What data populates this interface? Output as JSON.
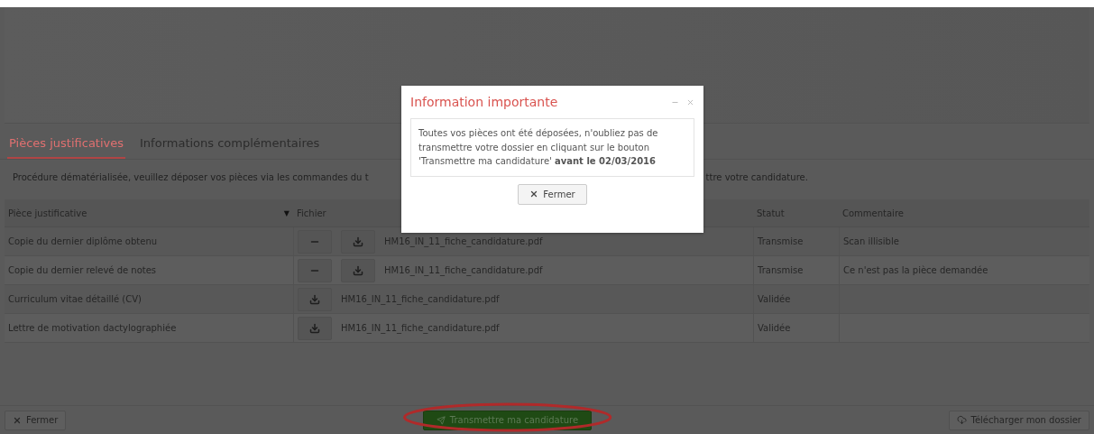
{
  "tabs": [
    {
      "label": "Pièces justificatives",
      "selected": true
    },
    {
      "label": "Informations complémentaires",
      "selected": false
    }
  ],
  "notice": {
    "before": "Procédure dématérialisée, veuillez déposer vos pièces via les commandes du t",
    "after": "ttre votre candidature."
  },
  "table": {
    "columns": [
      "Pièce justificative",
      "Fichier",
      "Statut",
      "Commentaire"
    ],
    "sort_indicator": "▼",
    "rows": [
      {
        "piece": "Copie du dernier diplôme obtenu",
        "removable": true,
        "file": "HM16_IN_11_fiche_candidature.pdf",
        "status": "Transmise",
        "comment": "Scan illisible"
      },
      {
        "piece": "Copie du dernier relevé de notes",
        "removable": true,
        "file": "HM16_IN_11_fiche_candidature.pdf",
        "status": "Transmise",
        "comment": "Ce n'est pas la pièce demandée"
      },
      {
        "piece": "Curriculum vitae détaillé (CV)",
        "removable": false,
        "file": "HM16_IN_11_fiche_candidature.pdf",
        "status": "Validée"
      },
      {
        "piece": "Lettre de motivation dactylographiée",
        "removable": false,
        "file": "HM16_IN_11_fiche_candidature.pdf",
        "status": "Validée"
      }
    ]
  },
  "footer": {
    "close": "Fermer",
    "submit": "Transmettre ma candidature",
    "download": "Télécharger mon dossier"
  },
  "modal": {
    "title": "Information importante",
    "message": "Toutes vos pièces ont été déposées, n'oubliez pas de transmettre votre dossier en cliquant sur le bouton 'Transmettre ma candidature' **avant le 02/03/2016**",
    "close": "Fermer"
  }
}
